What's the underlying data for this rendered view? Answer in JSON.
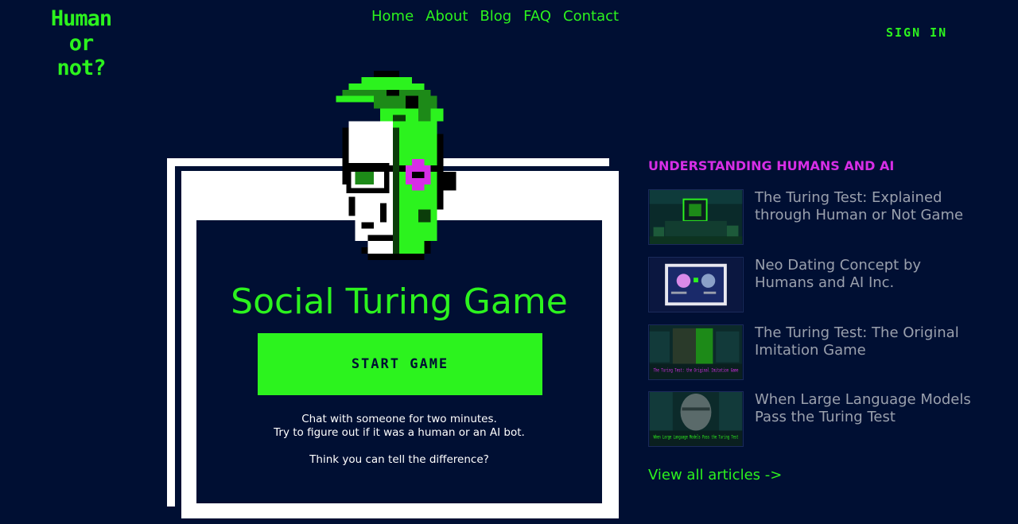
{
  "brand": {
    "logo_lines": [
      "Human",
      "or",
      "not?"
    ],
    "accent": "#2cf31e",
    "background": "#000f33",
    "highlight": "#d72ee6"
  },
  "nav": {
    "items": [
      "Home",
      "About",
      "Blog",
      "FAQ",
      "Contact"
    ]
  },
  "header": {
    "signin_label": "SIGN IN"
  },
  "hero": {
    "title": "Social Turing Game",
    "start_label": "START GAME",
    "line1": "Chat with someone for two minutes.",
    "line2": "Try to figure out if it was a human or an AI bot.",
    "question": "Think you can tell the difference?"
  },
  "sidebar": {
    "heading": "UNDERSTANDING HUMANS AND AI",
    "articles": [
      {
        "title": "The Turing Test: Explained through Human or Not Game",
        "thumb_icon": "computer-scene-thumbnail"
      },
      {
        "title": "Neo Dating Concept by Humans and AI Inc.",
        "thumb_icon": "dating-faces-thumbnail"
      },
      {
        "title": "The Turing Test: The Original Imitation Game",
        "thumb_icon": "face-circuit-thumbnail",
        "thumb_caption": "The Turing Test: the Original Imitation Game"
      },
      {
        "title": "When Large Language Models Pass the Turing Test",
        "thumb_icon": "face-portrait-thumbnail",
        "thumb_caption": "When Large Language Models Pass the Turing Test"
      }
    ],
    "view_all": "View all articles ->"
  }
}
